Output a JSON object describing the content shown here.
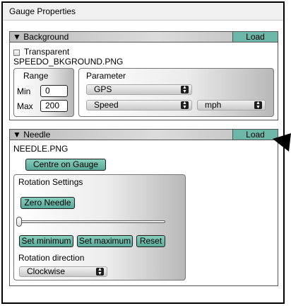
{
  "window": {
    "title": "Gauge Properties"
  },
  "background": {
    "header": "Background",
    "collapse_icon": "triangle-down-icon",
    "load_label": "Load",
    "transparent_label": "Transparent",
    "transparent_checked": false,
    "filename": "SPEEDO_BKGROUND.PNG",
    "range": {
      "title": "Range",
      "min_label": "Min",
      "min_value": "0",
      "max_label": "Max",
      "max_value": "200"
    },
    "parameter": {
      "title": "Parameter",
      "source": "GPS",
      "field": "Speed",
      "unit": "mph"
    }
  },
  "needle": {
    "header": "Needle",
    "collapse_icon": "triangle-down-icon",
    "load_label": "Load",
    "filename": "NEEDLE.PNG",
    "centre_label": "Centre on Gauge",
    "rotation": {
      "title": "Rotation Settings",
      "zero_label": "Zero Needle",
      "slider_value": 0,
      "set_min_label": "Set minimum",
      "set_max_label": "Set maximum",
      "reset_label": "Reset",
      "direction_label": "Rotation direction",
      "direction_value": "Clockwise"
    }
  },
  "colors": {
    "accent": "#6cb7a7",
    "header_grey": "#cfcfcf"
  }
}
